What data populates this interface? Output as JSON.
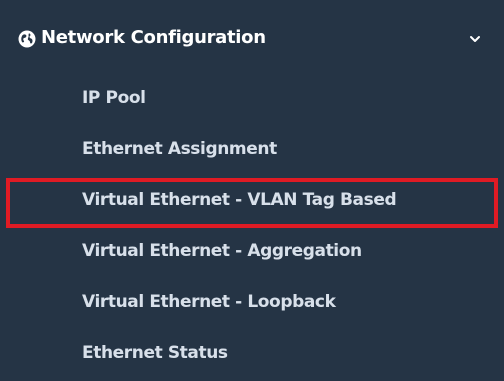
{
  "menu": {
    "header": {
      "label": "Network Configuration",
      "icon": "globe-icon",
      "expanded_icon": "chevron-down-icon"
    },
    "items": [
      {
        "label": "IP Pool"
      },
      {
        "label": "Ethernet Assignment"
      },
      {
        "label": "Virtual Ethernet - VLAN Tag Based",
        "highlighted": true
      },
      {
        "label": "Virtual Ethernet - Aggregation"
      },
      {
        "label": "Virtual Ethernet - Loopback"
      },
      {
        "label": "Ethernet Status"
      }
    ]
  },
  "colors": {
    "sidebar_bg": "#253445",
    "header_text": "#ffffff",
    "item_text": "#d8e0ea",
    "highlight": "#e01b24"
  }
}
